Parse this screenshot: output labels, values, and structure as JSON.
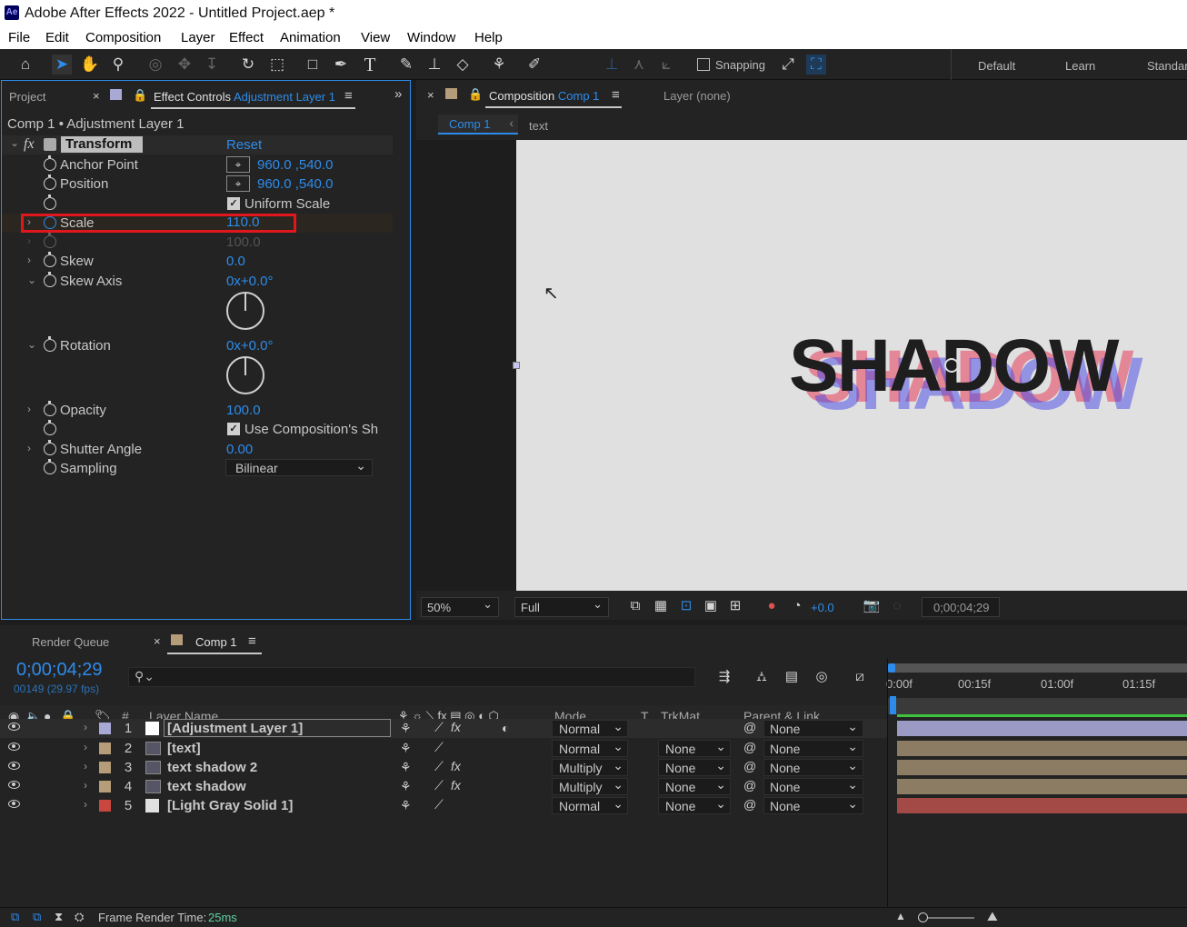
{
  "title_bar": {
    "app_icon": "Ae",
    "title": "Adobe After Effects 2022 - Untitled Project.aep *"
  },
  "menu": [
    "File",
    "Edit",
    "Composition",
    "Layer",
    "Effect",
    "Animation",
    "View",
    "Window",
    "Help"
  ],
  "toolbar": {
    "snapping_label": "Snapping",
    "workspaces": [
      "Default",
      "Learn",
      "Standar"
    ]
  },
  "left_panel": {
    "tab_project": "Project",
    "tab_effect_controls": "Effect Controls",
    "tab_effect_controls_layer": "Adjustment Layer 1",
    "breadcrumb": "Comp 1 • Adjustment Layer 1",
    "effect_name": "Transform",
    "reset_label": "Reset",
    "properties": {
      "anchor_point": {
        "label": "Anchor Point",
        "value": "960.0 ,540.0"
      },
      "position": {
        "label": "Position",
        "value": "960.0 ,540.0"
      },
      "uniform_scale": {
        "label": "Uniform Scale",
        "checked": true
      },
      "scale": {
        "label": "Scale",
        "value": "110.0"
      },
      "scale_width": {
        "value": "100.0"
      },
      "skew": {
        "label": "Skew",
        "value": "0.0"
      },
      "skew_axis": {
        "label": "Skew Axis",
        "value": "0x+0.0°"
      },
      "rotation": {
        "label": "Rotation",
        "value": "0x+0.0°"
      },
      "opacity": {
        "label": "Opacity",
        "value": "100.0"
      },
      "use_comp_shutter": {
        "label": "Use Composition's Sh",
        "checked": true
      },
      "shutter_angle": {
        "label": "Shutter Angle",
        "value": "0.00"
      },
      "sampling": {
        "label": "Sampling",
        "value": "Bilinear"
      }
    },
    "highlight_color": "#e0181e"
  },
  "comp_panel": {
    "tab_composition": "Composition",
    "tab_comp_name": "Comp 1",
    "tab_layer": "Layer (none)",
    "breadcrumb_comp": "Comp 1",
    "breadcrumb_layer": "text",
    "canvas_text": "SHADOW",
    "view": {
      "zoom": "50%",
      "resolution": "Full",
      "exposure": "+0.0",
      "timecode": "0;00;04;29"
    }
  },
  "timeline": {
    "tab_render_queue": "Render Queue",
    "tab_comp": "Comp 1",
    "current_time": "0;00;04;29",
    "frame_info": "00149 (29.97 fps)",
    "ruler": [
      "0:00f",
      "00:15f",
      "01:00f",
      "01:15f"
    ],
    "columns": {
      "num": "#",
      "layer_name": "Layer Name",
      "mode": "Mode",
      "t": "T",
      "trkmat": "TrkMat",
      "parent": "Parent & Link"
    },
    "layers": [
      {
        "num": "1",
        "name": "[Adjustment Layer 1]",
        "mode": "Normal",
        "trkmat": "",
        "parent": "None",
        "label_color": "#a9a9d6",
        "bar_color": "#9a9ac4"
      },
      {
        "num": "2",
        "name": "[text]",
        "mode": "Normal",
        "trkmat": "None",
        "parent": "None",
        "label_color": "#b59d79",
        "bar_color": "#8c7c64"
      },
      {
        "num": "3",
        "name": "text shadow 2",
        "mode": "Multiply",
        "trkmat": "None",
        "parent": "None",
        "label_color": "#b59d79",
        "bar_color": "#8c7c64"
      },
      {
        "num": "4",
        "name": "text shadow",
        "mode": "Multiply",
        "trkmat": "None",
        "parent": "None",
        "label_color": "#b59d79",
        "bar_color": "#8c7c64"
      },
      {
        "num": "5",
        "name": "[Light Gray Solid 1]",
        "mode": "Normal",
        "trkmat": "None",
        "parent": "None",
        "label_color": "#c9473f",
        "bar_color": "#a44a46"
      }
    ]
  },
  "status_bar": {
    "frame_render_label": "Frame Render Time:",
    "frame_render_value": "25ms"
  }
}
